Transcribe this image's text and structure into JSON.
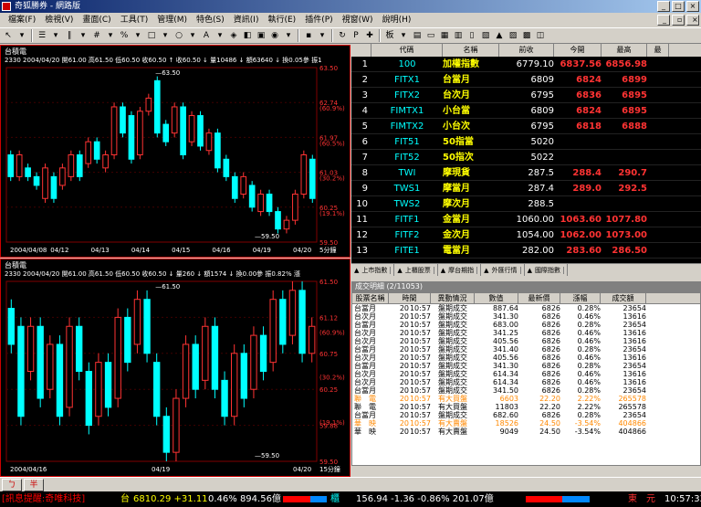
{
  "window": {
    "title": "奇狐勝券 - 網路版"
  },
  "menu": [
    "檔案(F)",
    "檢視(V)",
    "畫面(C)",
    "工具(T)",
    "管理(M)",
    "特色(S)",
    "資訊(I)",
    "執行(E)",
    "插件(P)",
    "視窗(W)",
    "說明(H)"
  ],
  "chart1": {
    "title": "台積電",
    "info": "2330 2004/04/20 開61.00 高61.50 低60.50 收60.50 ↑ 收60.50 ↓ 量10486 ↓ 額63640 ↓ 換0.05參 振1",
    "yticks": [
      "63.50",
      "62.74",
      "61.97",
      "61.03",
      "60.25",
      "59.50"
    ],
    "ypct": [
      "(60.9%)",
      "(60.5%)",
      "(30.2%)",
      "(19.1%)"
    ],
    "xticks": [
      "2004/04/08",
      "04/12",
      "04/13",
      "04/14",
      "04/15",
      "04/16",
      "04/19",
      "04/20"
    ],
    "period": "5分鐘",
    "hi_label": "63.50",
    "lo_label": "59.50"
  },
  "chart2": {
    "title": "台積電",
    "info": "2330 2004/04/20 開61.00 高61.50 低60.50 收60.50 ↓ 量260 ↓ 額1574 ↓ 換0.00參 振0.82% 漲",
    "yticks": [
      "61.50",
      "61.12",
      "60.75",
      "60.25",
      "59.88",
      "59.50"
    ],
    "ypct": [
      "(60.9%)",
      "(30.2%)",
      "(19.1%)"
    ],
    "xticks": [
      "2004/04/16",
      "04/19",
      "04/20"
    ],
    "period": "15分鐘",
    "hi_label": "61.50",
    "lo_label": "59.50"
  },
  "quotes": {
    "headers": [
      "代碼",
      "名稱",
      "前收",
      "今開",
      "最高",
      "最"
    ],
    "rows": [
      {
        "n": "1",
        "code": "100",
        "name": "加權指數",
        "prev": "6779.10",
        "open": "6837.56",
        "high": "6856.98",
        "c": "up"
      },
      {
        "n": "2",
        "code": "FITX1",
        "name": "台當月",
        "prev": "6809",
        "open": "6824",
        "high": "6899",
        "c": "up"
      },
      {
        "n": "3",
        "code": "FITX2",
        "name": "台次月",
        "prev": "6795",
        "open": "6836",
        "high": "6895",
        "c": "up"
      },
      {
        "n": "4",
        "code": "FIMTX1",
        "name": "小台當",
        "prev": "6809",
        "open": "6824",
        "high": "6895",
        "c": "up"
      },
      {
        "n": "5",
        "code": "FIMTX2",
        "name": "小台次",
        "prev": "6795",
        "open": "6818",
        "high": "6888",
        "c": "up"
      },
      {
        "n": "6",
        "code": "FIT51",
        "name": "50指當",
        "prev": "5020",
        "open": "",
        "high": "",
        "c": "fl"
      },
      {
        "n": "7",
        "code": "FIT52",
        "name": "50指次",
        "prev": "5022",
        "open": "",
        "high": "",
        "c": "fl"
      },
      {
        "n": "8",
        "code": "TWI",
        "name": "摩現貨",
        "prev": "287.5",
        "open": "288.4",
        "high": "290.7",
        "c": "up"
      },
      {
        "n": "9",
        "code": "TWS1",
        "name": "摩當月",
        "prev": "287.4",
        "open": "289.0",
        "high": "292.5",
        "c": "up"
      },
      {
        "n": "10",
        "code": "TWS2",
        "name": "摩次月",
        "prev": "288.5",
        "open": "",
        "high": "",
        "c": "fl"
      },
      {
        "n": "11",
        "code": "FITF1",
        "name": "金當月",
        "prev": "1060.00",
        "open": "1063.60",
        "high": "1077.80",
        "c": "up"
      },
      {
        "n": "12",
        "code": "FITF2",
        "name": "金次月",
        "prev": "1054.00",
        "open": "1062.00",
        "high": "1073.00",
        "c": "up"
      },
      {
        "n": "13",
        "code": "FITE1",
        "name": "電當月",
        "prev": "282.00",
        "open": "283.60",
        "high": "286.50",
        "c": "up"
      }
    ],
    "tabs": [
      "上市指數",
      "上櫃股票",
      "摩台期指",
      "外匯行情",
      "國際指數"
    ]
  },
  "trades": {
    "title": "成交明細 (2/11053)",
    "headers": [
      "股票名稱",
      "時間",
      "",
      "異動情況",
      "數值",
      "最新價",
      "漲幅",
      "成交額"
    ],
    "rows": [
      {
        "name": "台當月",
        "h": "20",
        "m": "10:57",
        "ev": "盤期成交",
        "val": "887.64",
        "price": "6826",
        "pct": "0.28%",
        "amt": "23654",
        "c": ""
      },
      {
        "name": "台次月",
        "h": "20",
        "m": "10:57",
        "ev": "盤期成交",
        "val": "341.30",
        "price": "6826",
        "pct": "0.46%",
        "amt": "13616",
        "c": ""
      },
      {
        "name": "台當月",
        "h": "20",
        "m": "10:57",
        "ev": "盤期成交",
        "val": "683.00",
        "price": "6826",
        "pct": "0.28%",
        "amt": "23654",
        "c": ""
      },
      {
        "name": "台次月",
        "h": "20",
        "m": "10:57",
        "ev": "盤期成交",
        "val": "341.25",
        "price": "6826",
        "pct": "0.46%",
        "amt": "13616",
        "c": ""
      },
      {
        "name": "台次月",
        "h": "20",
        "m": "10:57",
        "ev": "盤期成交",
        "val": "405.56",
        "price": "6826",
        "pct": "0.46%",
        "amt": "13616",
        "c": ""
      },
      {
        "name": "台當月",
        "h": "20",
        "m": "10:57",
        "ev": "盤期成交",
        "val": "341.40",
        "price": "6826",
        "pct": "0.28%",
        "amt": "23654",
        "c": ""
      },
      {
        "name": "台次月",
        "h": "20",
        "m": "10:57",
        "ev": "盤期成交",
        "val": "405.56",
        "price": "6826",
        "pct": "0.46%",
        "amt": "13616",
        "c": ""
      },
      {
        "name": "台當月",
        "h": "20",
        "m": "10:57",
        "ev": "盤期成交",
        "val": "341.30",
        "price": "6826",
        "pct": "0.28%",
        "amt": "23654",
        "c": ""
      },
      {
        "name": "台次月",
        "h": "20",
        "m": "10:57",
        "ev": "盤期成交",
        "val": "614.34",
        "price": "6826",
        "pct": "0.46%",
        "amt": "13616",
        "c": ""
      },
      {
        "name": "台次月",
        "h": "20",
        "m": "10:57",
        "ev": "盤期成交",
        "val": "614.34",
        "price": "6826",
        "pct": "0.46%",
        "amt": "13616",
        "c": ""
      },
      {
        "name": "台當月",
        "h": "20",
        "m": "10:57",
        "ev": "盤期成交",
        "val": "341.50",
        "price": "6826",
        "pct": "0.28%",
        "amt": "23654",
        "c": ""
      },
      {
        "name": "聯　電",
        "h": "20",
        "m": "10:57",
        "ev": "有大買盤",
        "val": "6603",
        "price": "22.20",
        "pct": "2.22%",
        "amt": "265578",
        "c": "tr-or"
      },
      {
        "name": "聯　電",
        "h": "20",
        "m": "10:57",
        "ev": "有大買盤",
        "val": "11803",
        "price": "22.20",
        "pct": "2.22%",
        "amt": "265578",
        "c": ""
      },
      {
        "name": "台當月",
        "h": "20",
        "m": "10:57",
        "ev": "盤期成交",
        "val": "682.60",
        "price": "6826",
        "pct": "0.28%",
        "amt": "23654",
        "c": ""
      },
      {
        "name": "華　映",
        "h": "20",
        "m": "10:57",
        "ev": "有大賣盤",
        "val": "18526",
        "price": "24.50",
        "pct": "-3.54%",
        "amt": "404866",
        "c": "tr-or"
      },
      {
        "name": "華　映",
        "h": "20",
        "m": "10:57",
        "ev": "有大賣盤",
        "val": "9049",
        "price": "24.50",
        "pct": "-3.54%",
        "amt": "404866",
        "c": ""
      }
    ]
  },
  "ticker": {
    "news": "[訊息提醒:奇唯科技]",
    "idx_label": "台",
    "idx": "6810.29 +31.11",
    "idx_pct": "0.46% 894.56億",
    "otc_label": "櫃",
    "otc": "156.94 -1.36 -0.86% 201.07億",
    "conn": "東　元",
    "time": "10:57:33"
  },
  "buttons": [
    "ㄅ",
    "半"
  ],
  "colors": {
    "accent": "#0a246a",
    "up": "#ff3333",
    "down": "#00ff00",
    "cyan": "#00ffff",
    "frame": "#cc0000"
  },
  "chart1_data": [
    {
      "o": 61.5,
      "c": 61.0
    },
    {
      "o": 61.0,
      "c": 61.5
    },
    {
      "o": 61.2,
      "c": 61.0
    },
    {
      "o": 61.0,
      "c": 60.8
    },
    {
      "o": 60.5,
      "c": 61.2
    },
    {
      "o": 61.0,
      "c": 60.5
    },
    {
      "o": 60.8,
      "c": 61.2
    },
    {
      "o": 61.0,
      "c": 61.5
    },
    {
      "o": 61.5,
      "c": 61.0
    },
    {
      "o": 61.3,
      "c": 61.8
    },
    {
      "o": 61.8,
      "c": 61.4
    },
    {
      "o": 61.2,
      "c": 61.5
    },
    {
      "o": 61.5,
      "c": 62.6
    },
    {
      "o": 62.6,
      "c": 62.0
    },
    {
      "o": 62.4,
      "c": 61.4
    },
    {
      "o": 61.5,
      "c": 62.5
    },
    {
      "o": 62.5,
      "c": 62.8
    },
    {
      "o": 63.2,
      "c": 62.0
    },
    {
      "o": 62.2,
      "c": 61.8
    },
    {
      "o": 62.0,
      "c": 62.6
    },
    {
      "o": 62.6,
      "c": 61.5
    },
    {
      "o": 61.8,
      "c": 62.4
    },
    {
      "o": 62.4,
      "c": 61.7
    },
    {
      "o": 61.6,
      "c": 62.0
    },
    {
      "o": 62.0,
      "c": 61.2
    },
    {
      "o": 61.4,
      "c": 61.0
    },
    {
      "o": 61.0,
      "c": 60.5
    },
    {
      "o": 60.6,
      "c": 61.0
    },
    {
      "o": 60.8,
      "c": 60.3
    },
    {
      "o": 60.2,
      "c": 60.6
    },
    {
      "o": 60.6,
      "c": 60.2
    },
    {
      "o": 60.2,
      "c": 59.8
    },
    {
      "o": 59.8,
      "c": 60.0
    },
    {
      "o": 60.0,
      "c": 60.6
    },
    {
      "o": 60.6,
      "c": 61.5
    },
    {
      "o": 61.4,
      "c": 60.5
    }
  ],
  "chart2_data": [
    {
      "o": 61.2,
      "c": 60.8
    },
    {
      "o": 61.0,
      "c": 60.0
    },
    {
      "o": 60.5,
      "c": 61.0
    },
    {
      "o": 61.0,
      "c": 60.2
    },
    {
      "o": 60.3,
      "c": 60.8
    },
    {
      "o": 60.8,
      "c": 60.0
    },
    {
      "o": 60.1,
      "c": 61.0
    },
    {
      "o": 61.0,
      "c": 60.5
    },
    {
      "o": 60.5,
      "c": 59.9
    },
    {
      "o": 60.0,
      "c": 60.6
    },
    {
      "o": 60.6,
      "c": 60.1
    },
    {
      "o": 60.2,
      "c": 61.1
    },
    {
      "o": 61.1,
      "c": 60.6
    },
    {
      "o": 60.8,
      "c": 61.3
    },
    {
      "o": 61.3,
      "c": 60.7
    },
    {
      "o": 60.6,
      "c": 60.0
    },
    {
      "o": 60.0,
      "c": 59.6
    },
    {
      "o": 59.6,
      "c": 60.2
    },
    {
      "o": 60.2,
      "c": 60.8
    },
    {
      "o": 60.8,
      "c": 60.3
    },
    {
      "o": 60.4,
      "c": 61.0
    },
    {
      "o": 61.0,
      "c": 60.3
    },
    {
      "o": 60.4,
      "c": 60.0
    },
    {
      "o": 60.0,
      "c": 60.7
    },
    {
      "o": 60.7,
      "c": 60.2
    },
    {
      "o": 60.3,
      "c": 60.9
    },
    {
      "o": 60.9,
      "c": 60.5
    },
    {
      "o": 60.6,
      "c": 61.3
    },
    {
      "o": 61.3,
      "c": 60.8
    },
    {
      "o": 60.9,
      "c": 61.4
    },
    {
      "o": 61.4,
      "c": 60.7
    },
    {
      "o": 60.7,
      "c": 61.0
    }
  ]
}
